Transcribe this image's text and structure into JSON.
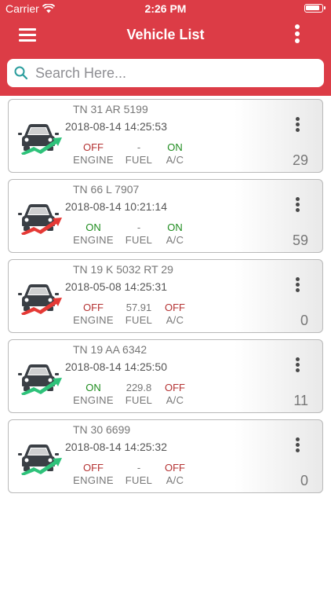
{
  "status_bar": {
    "carrier": "Carrier",
    "time": "2:26 PM"
  },
  "header": {
    "title": "Vehicle List"
  },
  "search": {
    "placeholder": "Search Here..."
  },
  "labels": {
    "engine": "ENGINE",
    "fuel": "FUEL",
    "ac": "A/C"
  },
  "colors": {
    "brand": "#dc3c46",
    "on": "#1e8c1e",
    "off": "#b43232",
    "trend_up": "#2ec27a",
    "trend_down": "#e53935"
  },
  "vehicles": [
    {
      "plate": "TN 31 AR 5199",
      "timestamp": "2018-08-14 14:25:53",
      "engine": "OFF",
      "fuel": "-",
      "ac": "ON",
      "count": "29",
      "trend": "green"
    },
    {
      "plate": "TN 66 L 7907",
      "timestamp": "2018-08-14 10:21:14",
      "engine": "ON",
      "fuel": "-",
      "ac": "ON",
      "count": "59",
      "trend": "red"
    },
    {
      "plate": "TN 19 K 5032 RT 29",
      "timestamp": "2018-05-08 14:25:31",
      "engine": "OFF",
      "fuel": "57.91",
      "ac": "OFF",
      "count": "0",
      "trend": "red"
    },
    {
      "plate": "TN 19 AA 6342",
      "timestamp": "2018-08-14 14:25:50",
      "engine": "ON",
      "fuel": "229.8",
      "ac": "OFF",
      "count": "11",
      "trend": "green"
    },
    {
      "plate": "TN 30 6699",
      "timestamp": "2018-08-14 14:25:32",
      "engine": "OFF",
      "fuel": "-",
      "ac": "OFF",
      "count": "0",
      "trend": "green"
    }
  ]
}
